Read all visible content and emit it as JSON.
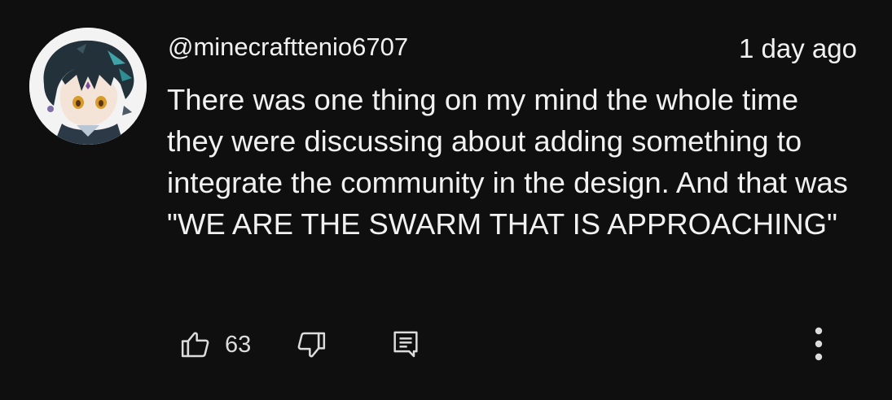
{
  "comment": {
    "author": "@minecrafttenio6707",
    "timestamp": "1 day ago",
    "text": "There was one thing on my mind the whole time they were discussing about adding something to integrate the community in the design. And that was \"WE ARE THE SWARM THAT IS APPROACHING\"",
    "avatar_icon": "anime-character-avatar"
  },
  "actions": {
    "like_icon": "thumbs-up-icon",
    "like_count": "63",
    "dislike_icon": "thumbs-down-icon",
    "reply_icon": "reply-comment-icon",
    "more_icon": "more-vertical-icon"
  },
  "colors": {
    "background": "#0f0f0f",
    "text": "#f1f1f1",
    "icon": "#dcdcdc"
  }
}
